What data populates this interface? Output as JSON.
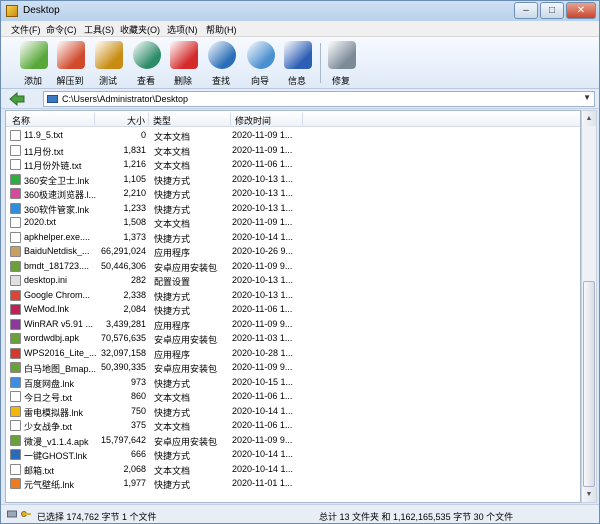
{
  "window": {
    "title": "Desktop"
  },
  "menu": [
    "文件(F)",
    "命令(C)",
    "工具(S)",
    "收藏夹(O)",
    "选项(N)",
    "帮助(H)"
  ],
  "toolbar": [
    {
      "label": "添加",
      "icon": "add-icon",
      "color": "#58a83a"
    },
    {
      "label": "解压到",
      "icon": "extract-icon",
      "color": "#d04a2c"
    },
    {
      "label": "测试",
      "icon": "test-icon",
      "color": "#c98c12"
    },
    {
      "label": "查看",
      "icon": "view-icon",
      "color": "#2e8c6a"
    },
    {
      "label": "删除",
      "icon": "delete-icon",
      "color": "#d32a2a"
    },
    {
      "label": "查找",
      "icon": "find-icon",
      "color": "#2b6fb8"
    },
    {
      "label": "向导",
      "icon": "wizard-icon",
      "color": "#4a8fd0"
    },
    {
      "label": "信息",
      "icon": "info-icon",
      "color": "#2d5fb5"
    },
    {
      "label": "修复",
      "icon": "repair-icon",
      "color": "#7c8a98"
    }
  ],
  "address": {
    "path": "C:\\Users\\Administrator\\Desktop"
  },
  "columns": {
    "name": "名称",
    "size": "大小",
    "type": "类型",
    "modified": "修改时间"
  },
  "files": [
    {
      "name": "11.9_5.txt",
      "size": "0",
      "type": "文本文档",
      "modified": "2020-11-09 1...",
      "color": "#ffffff"
    },
    {
      "name": "11月份.txt",
      "size": "1,831",
      "type": "文本文档",
      "modified": "2020-11-09 1...",
      "color": "#ffffff"
    },
    {
      "name": "11月份外链.txt",
      "size": "1,216",
      "type": "文本文档",
      "modified": "2020-11-06 1...",
      "color": "#ffffff"
    },
    {
      "name": "360安全卫士.lnk",
      "size": "1,105",
      "type": "快捷方式",
      "modified": "2020-10-13 1...",
      "color": "#2fae3e"
    },
    {
      "name": "360极速浏览器.l...",
      "size": "2,210",
      "type": "快捷方式",
      "modified": "2020-10-13 1...",
      "color": "#d6499d"
    },
    {
      "name": "360软件管家.lnk",
      "size": "1,233",
      "type": "快捷方式",
      "modified": "2020-10-13 1...",
      "color": "#2f8de0"
    },
    {
      "name": "2020.txt",
      "size": "1,508",
      "type": "文本文档",
      "modified": "2020-11-09 1...",
      "color": "#ffffff"
    },
    {
      "name": "apkhelper.exe....",
      "size": "1,373",
      "type": "快捷方式",
      "modified": "2020-10-14 1...",
      "color": "#ffffff"
    },
    {
      "name": "BaiduNetdisk_...",
      "size": "66,291,024",
      "type": "应用程序",
      "modified": "2020-10-26 9...",
      "color": "#c8a060"
    },
    {
      "name": "bmdt_181723....",
      "size": "50,446,306",
      "type": "安卓应用安装包",
      "modified": "2020-11-09 9...",
      "color": "#6a9f3a"
    },
    {
      "name": "desktop.ini",
      "size": "282",
      "type": "配置设置",
      "modified": "2020-10-13 1...",
      "color": "#e0e0e0"
    },
    {
      "name": "Google Chrom...",
      "size": "2,338",
      "type": "快捷方式",
      "modified": "2020-10-13 1...",
      "color": "#db4437"
    },
    {
      "name": "WeMod.lnk",
      "size": "2,084",
      "type": "快捷方式",
      "modified": "2020-11-06 1...",
      "color": "#c21f5b"
    },
    {
      "name": "WinRAR v5.91 ...",
      "size": "3,439,281",
      "type": "应用程序",
      "modified": "2020-11-09 9...",
      "color": "#8b3a9c"
    },
    {
      "name": "wordwdbj.apk",
      "size": "70,576,635",
      "type": "安卓应用安装包",
      "modified": "2020-11-03 1...",
      "color": "#6a9f3a"
    },
    {
      "name": "WPS2016_Lite_...",
      "size": "32,097,158",
      "type": "应用程序",
      "modified": "2020-10-28 1...",
      "color": "#d43b2b"
    },
    {
      "name": "白马地图_Bmap...",
      "size": "50,390,335",
      "type": "安卓应用安装包",
      "modified": "2020-11-09 9...",
      "color": "#6a9f3a"
    },
    {
      "name": "百度网盘.lnk",
      "size": "973",
      "type": "快捷方式",
      "modified": "2020-10-15 1...",
      "color": "#3c8ee3"
    },
    {
      "name": "今日之号.txt",
      "size": "860",
      "type": "文本文档",
      "modified": "2020-11-06 1...",
      "color": "#ffffff"
    },
    {
      "name": "雷电模拟器.lnk",
      "size": "750",
      "type": "快捷方式",
      "modified": "2020-10-14 1...",
      "color": "#f2b60f"
    },
    {
      "name": "少女战争.txt",
      "size": "375",
      "type": "文本文档",
      "modified": "2020-11-06 1...",
      "color": "#ffffff"
    },
    {
      "name": "微漫_v1.1.4.apk",
      "size": "15,797,642",
      "type": "安卓应用安装包",
      "modified": "2020-11-09 9...",
      "color": "#6a9f3a"
    },
    {
      "name": "一键GHOST.lnk",
      "size": "666",
      "type": "快捷方式",
      "modified": "2020-10-14 1...",
      "color": "#2a6ab8"
    },
    {
      "name": "邮箱.txt",
      "size": "2,068",
      "type": "文本文档",
      "modified": "2020-10-14 1...",
      "color": "#ffffff"
    },
    {
      "name": "元气壁纸.lnk",
      "size": "1,977",
      "type": "快捷方式",
      "modified": "2020-11-01 1...",
      "color": "#f07b1f"
    }
  ],
  "status": {
    "left": "已选择 174,762 字节 1 个文件",
    "right": "总计 13 文件夹 和 1,162,165,535 字节 30 个文件"
  }
}
